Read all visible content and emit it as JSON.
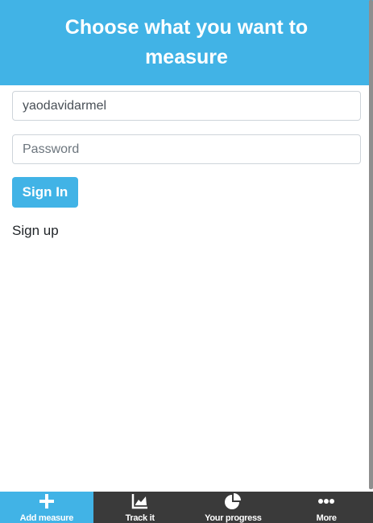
{
  "header": {
    "title": "Choose what you want to measure"
  },
  "form": {
    "username_value": "yaodavidarmel",
    "password_placeholder": "Password",
    "signin_label": "Sign In",
    "signup_label": "Sign up"
  },
  "tabbar": {
    "tabs": [
      {
        "label": "Add measure",
        "icon": "plus-icon",
        "active": true
      },
      {
        "label": "Track it",
        "icon": "chart-icon",
        "active": false
      },
      {
        "label": "Your progress",
        "icon": "pie-chart-icon",
        "active": false
      },
      {
        "label": "More",
        "icon": "more-icon",
        "active": false
      }
    ]
  },
  "colors": {
    "brand": "#41b3e6",
    "tabbar": "#3a3a3a"
  }
}
